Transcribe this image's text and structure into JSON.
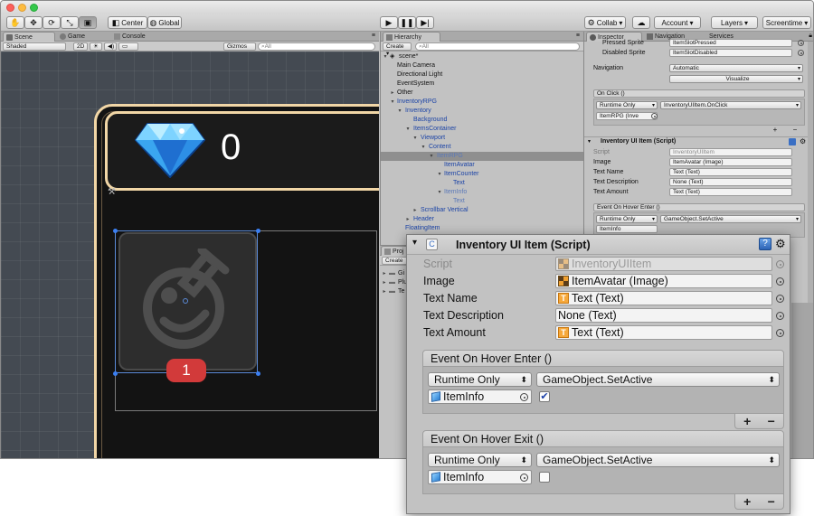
{
  "toolbar": {
    "pivot": "Center",
    "space": "Global",
    "collab": "Collab",
    "account": "Account",
    "layers": "Layers",
    "layout": "Screentime"
  },
  "scene": {
    "tabs": [
      "Scene",
      "Game",
      "Console"
    ],
    "shading": "Shaded",
    "mode_2d": "2D",
    "gizmos": "Gizmos",
    "search_placeholder": "All",
    "gem_count": "0",
    "badge_count": "1"
  },
  "hierarchy": {
    "tab": "Hierarchy",
    "create": "Create",
    "search_placeholder": "All",
    "scene_name": "scene*",
    "items": [
      {
        "label": "Main Camera"
      },
      {
        "label": "Directional Light"
      },
      {
        "label": "EventSystem"
      },
      {
        "label": "Other"
      },
      {
        "label": "InventoryRPG"
      },
      {
        "label": "Inventory"
      },
      {
        "label": "Background"
      },
      {
        "label": "ItemsContainer"
      },
      {
        "label": "Viewport"
      },
      {
        "label": "Content"
      },
      {
        "label": "ItemRPG"
      },
      {
        "label": "ItemAvatar"
      },
      {
        "label": "ItemCounter"
      },
      {
        "label": "Text"
      },
      {
        "label": "ItemInfo"
      },
      {
        "label": "Text"
      },
      {
        "label": "Scrollbar Vertical"
      },
      {
        "label": "Header"
      },
      {
        "label": "FloatingItem"
      }
    ]
  },
  "project": {
    "tab": "Proj",
    "create": "Create",
    "folders": [
      "Gi",
      "Plu",
      "Te"
    ]
  },
  "inspector": {
    "tabs": [
      "Inspector",
      "Navigation",
      "Services"
    ],
    "pressed_sprite_label": "Pressed Sprite",
    "pressed_sprite_value": "ItemSlotPressed",
    "disabled_sprite_label": "Disabled Sprite",
    "disabled_sprite_value": "ItemSlotDisabled",
    "navigation_label": "Navigation",
    "navigation_value": "Automatic",
    "visualize": "Visualize",
    "on_click": "On Click ()",
    "runtime_only": "Runtime Only",
    "on_click_function": "InventoryUIItem.OnClick",
    "on_click_target": "ItemRPG (Inve",
    "component_title": "Inventory UI Item (Script)",
    "script_label": "Script",
    "script_value": "InventoryUIItem",
    "image_label": "Image",
    "image_value": "ItemAvatar (Image)",
    "text_name_label": "Text Name",
    "text_name_value": "Text (Text)",
    "text_desc_label": "Text Description",
    "text_desc_value": "None (Text)",
    "text_amount_label": "Text Amount",
    "text_amount_value": "Text (Text)",
    "hover_enter": "Event On Hover Enter ()",
    "hover_function": "GameObject.SetActive",
    "hover_target": "ItemInfo"
  },
  "popup": {
    "title": "Inventory UI Item (Script)",
    "fields": [
      {
        "label": "Script",
        "value": "InventoryUIItem"
      },
      {
        "label": "Image",
        "value": "ItemAvatar (Image)"
      },
      {
        "label": "Text Name",
        "value": "Text (Text)"
      },
      {
        "label": "Text Description",
        "value": "None (Text)"
      },
      {
        "label": "Text Amount",
        "value": "Text (Text)"
      }
    ],
    "events": [
      {
        "title": "Event On Hover Enter ()",
        "mode": "Runtime Only",
        "function": "GameObject.SetActive",
        "target": "ItemInfo",
        "checked": true
      },
      {
        "title": "Event On Hover Exit ()",
        "mode": "Runtime Only",
        "function": "GameObject.SetActive",
        "target": "ItemInfo",
        "checked": false
      }
    ],
    "plus": "+",
    "minus": "−"
  },
  "icons": {
    "hand": "hand-tool-icon",
    "move": "move-tool-icon",
    "rotate": "rotate-tool-icon",
    "scale": "scale-tool-icon",
    "rect": "rect-tool-icon",
    "play": "play-icon",
    "pause": "pause-icon",
    "step": "step-icon",
    "cloud": "cloud-icon",
    "gem": "diamond-gem-icon",
    "potion": "potion-flask-icon",
    "help": "help-icon",
    "gear": "gear-icon"
  },
  "colors": {
    "frame": "#f1d6a6",
    "badge": "#d23a3a",
    "selection": "#3b7ff2",
    "hierarchy_blue": "#1b43a6"
  }
}
